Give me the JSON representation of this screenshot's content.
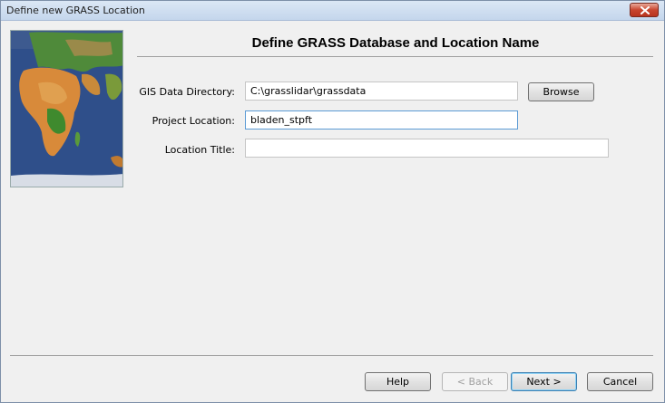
{
  "window": {
    "title": "Define new GRASS Location"
  },
  "heading": "Define GRASS Database and Location Name",
  "form": {
    "gis_dir_label": "GIS Data Directory:",
    "gis_dir_value": "C:\\grasslidar\\grassdata",
    "browse_label": "Browse",
    "project_label": "Project Location:",
    "project_value": "bladen_stpft",
    "title_label": "Location Title:",
    "title_value": ""
  },
  "footer": {
    "help": "Help",
    "back": "< Back",
    "next": "Next >",
    "cancel": "Cancel"
  },
  "icons": {
    "close": "close-icon",
    "side_image": "world-map-image"
  },
  "colors": {
    "focus_border": "#5b9bd5",
    "close_button": "#c8452e"
  }
}
